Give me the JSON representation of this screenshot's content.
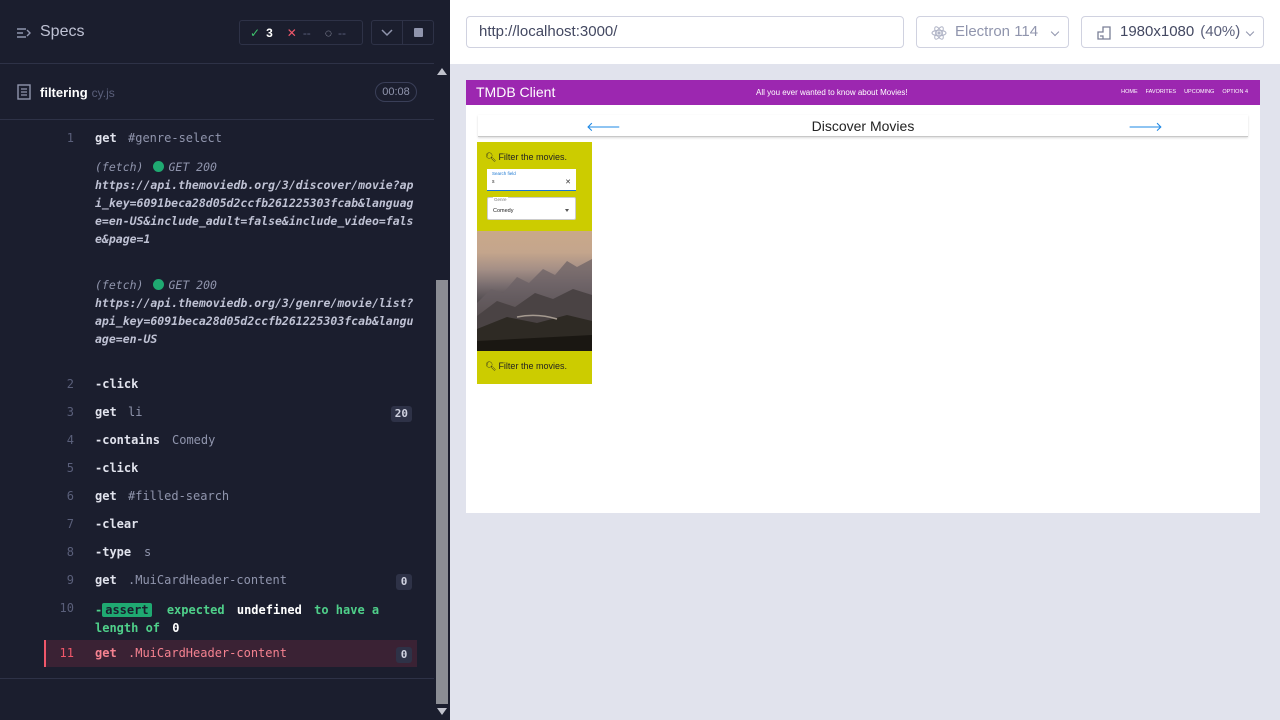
{
  "specs": {
    "title": "Specs"
  },
  "stats": {
    "passed": "3",
    "failed": "--",
    "pending": "--"
  },
  "file": {
    "name": "filtering",
    "ext": "cy.js",
    "duration": "00:08"
  },
  "commands": [
    {
      "num": "1",
      "name": "get",
      "msg": "#genre-select"
    },
    {
      "num": "2",
      "name": "-click",
      "msg": ""
    },
    {
      "num": "3",
      "name": "get",
      "msg": "li",
      "badge": "20"
    },
    {
      "num": "4",
      "name": "-contains",
      "msg": "Comedy"
    },
    {
      "num": "5",
      "name": "-click",
      "msg": ""
    },
    {
      "num": "6",
      "name": "get",
      "msg": "#filled-search"
    },
    {
      "num": "7",
      "name": "-clear",
      "msg": ""
    },
    {
      "num": "8",
      "name": "-type",
      "msg": "s"
    },
    {
      "num": "9",
      "name": "get",
      "msg": ".MuiCardHeader-content",
      "badge": "0"
    },
    {
      "num": "10",
      "name": "-",
      "tag": "assert",
      "text1": "expected",
      "strong1": "undefined",
      "text2": "to have a",
      "text3": "length of",
      "strong2": "0"
    },
    {
      "num": "11",
      "name": "get",
      "msg": ".MuiCardHeader-content",
      "badge": "0"
    }
  ],
  "fetches": [
    {
      "label": "(fetch)",
      "status": "GET 200",
      "url": "https://api.themoviedb.org/3/discover/movie?api_key=6091beca28d05d2ccfb261225303fcab&language=en-US&include_adult=false&include_video=false&page=1"
    },
    {
      "label": "(fetch)",
      "status": "GET 200",
      "url": "https://api.themoviedb.org/3/genre/movie/list?api_key=6091beca28d05d2ccfb261225303fcab&language=en-US"
    }
  ],
  "topbar": {
    "url": "http://localhost:3000/",
    "browser": "Electron 114",
    "viewport": "1980x1080",
    "viewport_pct": "(40%)"
  },
  "app": {
    "title": "TMDB Client",
    "tagline": "All you ever wanted to know about Movies!",
    "nav": [
      "HOME",
      "FAVORITES",
      "UPCOMING",
      "OPTION 4"
    ],
    "page_title": "Discover Movies",
    "filter_heading": "Filter the movies.",
    "search_label": "Search field",
    "search_value": "s",
    "genre_label": "Genre",
    "genre_value": "Comedy"
  },
  "colors": {
    "appbar": "#9c27b0",
    "filter_card": "#cccc00",
    "pass": "#3ec46d",
    "fail": "#f0576a"
  }
}
